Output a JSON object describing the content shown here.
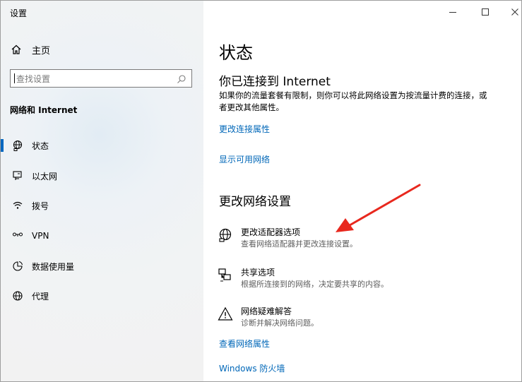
{
  "window": {
    "title": "设置"
  },
  "sidebar": {
    "home_label": "主页",
    "search_placeholder": "查找设置",
    "section_title": "网络和 Internet",
    "items": [
      {
        "label": "状态",
        "icon": "network-status-icon",
        "active": true
      },
      {
        "label": "以太网",
        "icon": "ethernet-icon",
        "active": false
      },
      {
        "label": "拨号",
        "icon": "dialup-icon",
        "active": false
      },
      {
        "label": "VPN",
        "icon": "vpn-icon",
        "active": false
      },
      {
        "label": "数据使用量",
        "icon": "data-usage-icon",
        "active": false
      },
      {
        "label": "代理",
        "icon": "proxy-icon",
        "active": false
      }
    ]
  },
  "main": {
    "page_title": "状态",
    "connected_heading": "你已连接到 Internet",
    "connected_desc": "如果你的流量套餐有限制，则你可以将此网络设置为按流量计费的连接，或者更改其他属性。",
    "link_change_props": "更改连接属性",
    "link_show_networks": "显示可用网络",
    "change_heading": "更改网络设置",
    "options": [
      {
        "title": "更改适配器选项",
        "desc": "查看网络适配器并更改连接设置。",
        "icon": "adapter-icon"
      },
      {
        "title": "共享选项",
        "desc": "根据所连接到的网络，决定要共享的内容。",
        "icon": "sharing-icon"
      },
      {
        "title": "网络疑难解答",
        "desc": "诊断并解决网络问题。",
        "icon": "warning-icon"
      }
    ],
    "link_view_props": "查看网络属性",
    "link_firewall": "Windows 防火墙"
  },
  "colors": {
    "accent": "#0067c0",
    "link": "#0067b8",
    "annotation_arrow": "#e8281e"
  }
}
